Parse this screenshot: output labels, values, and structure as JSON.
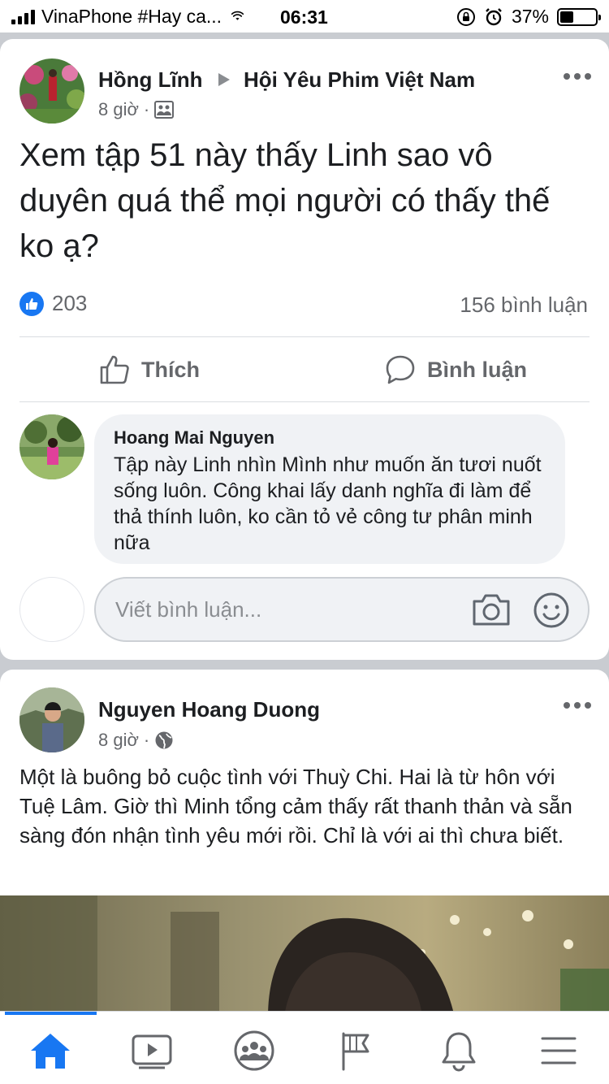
{
  "status_bar": {
    "carrier": "VinaPhone #Hay ca...",
    "time": "06:31",
    "battery": "37%",
    "battery_level": 0.37
  },
  "post1": {
    "author": "Hồng Lĩnh",
    "group": "Hội Yêu Phim Việt Nam",
    "time": "8 giờ",
    "separator": "·",
    "audience_icon": "group-icon",
    "text": "Xem tập 51 này thấy Linh sao vô duyên quá thể mọi người có thấy thế ko ạ?",
    "reaction_count": "203",
    "comment_count": "156 bình luận",
    "actions": {
      "like": "Thích",
      "comment": "Bình luận"
    },
    "top_comment": {
      "author": "Hoang Mai Nguyen",
      "text": "Tập này Linh nhìn Mình như muốn ăn tươi nuốt sống luôn. Công khai lấy danh nghĩa đi làm để thả thính luôn, ko cần tỏ vẻ công tư phân minh nữa"
    },
    "write_comment": {
      "placeholder": "Viết bình luận..."
    }
  },
  "post2": {
    "author": "Nguyen Hoang Duong",
    "time": "8 giờ",
    "separator": "·",
    "audience_icon": "globe-icon",
    "text": "Một là buông bỏ cuộc tình với Thuỳ Chi. Hai là từ hôn với Tuệ Lâm. Giờ thì Minh tổng cảm thấy rất thanh thản và sẵn sàng đón nhận tình yêu mới rồi. Chỉ là với ai thì chưa biết."
  },
  "bottom_nav": {
    "items": [
      "home-icon",
      "video-icon",
      "groups-icon",
      "pages-icon",
      "notifications-icon",
      "menu-icon"
    ],
    "active": "home-icon"
  },
  "colors": {
    "accent": "#1877f2",
    "text": "#1c1e21",
    "secondary_text": "#65676b",
    "background": "#c9ccd1"
  }
}
